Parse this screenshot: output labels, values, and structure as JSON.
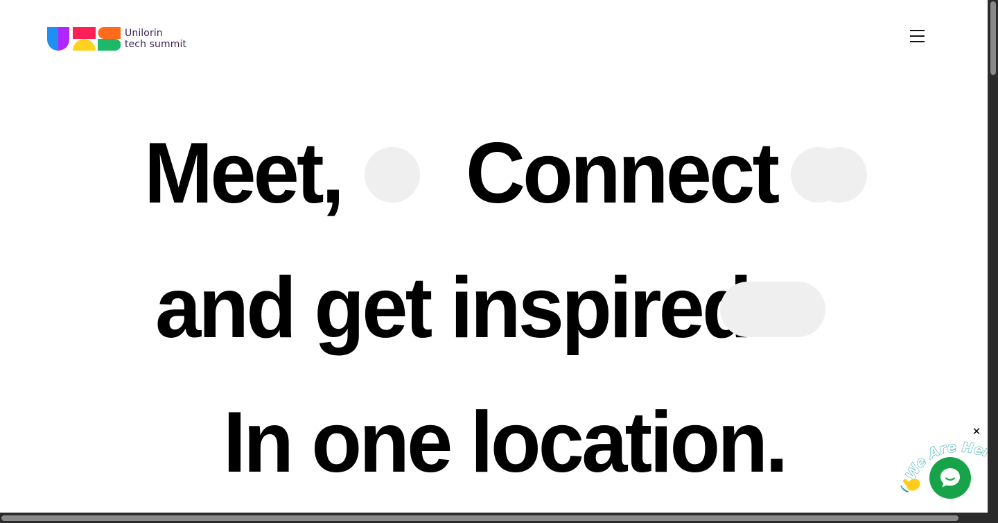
{
  "header": {
    "logo_line1": "Unilorin",
    "logo_line2": "tech summit",
    "menu_icon": "hamburger-menu-icon"
  },
  "hero": {
    "line1_word1": "Meet,",
    "line1_word2": "Connect",
    "line2": "and get inspired",
    "line3": "In one location."
  },
  "chat_widget": {
    "label": "We Are Here!",
    "close_symbol": "✕",
    "icon": "chat-bubble-icon"
  },
  "colors": {
    "logo_text": "#3d1f56",
    "logo_blue": "#1f8ff2",
    "logo_purple": "#b026ff",
    "logo_red": "#ff1f57",
    "logo_yellow": "#ffd21f",
    "logo_orange": "#ff6b1a",
    "logo_green": "#1db86a",
    "chat_green": "#16a34a",
    "blob": "#efefef"
  }
}
